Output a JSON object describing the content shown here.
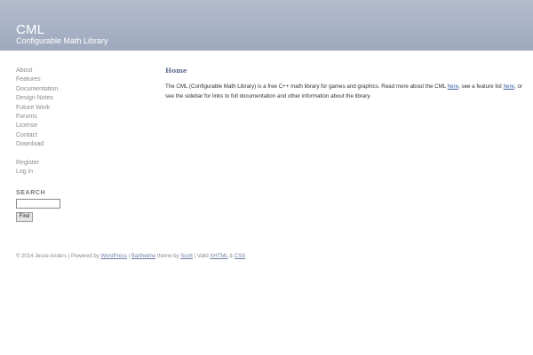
{
  "header": {
    "title": "CML",
    "description": "Configurable Math Library"
  },
  "sidebar": {
    "nav": [
      {
        "label": "About"
      },
      {
        "label": "Features"
      },
      {
        "label": "Documentation"
      },
      {
        "label": "Design Notes"
      },
      {
        "label": "Future Work"
      },
      {
        "label": "Forums"
      },
      {
        "label": "License"
      },
      {
        "label": "Contact"
      },
      {
        "label": "Download"
      }
    ],
    "meta": [
      {
        "label": "Register"
      },
      {
        "label": "Log in"
      }
    ],
    "search": {
      "heading": "SEARCH",
      "input_value": "",
      "button_label": "Find"
    }
  },
  "main": {
    "title": "Home",
    "intro": {
      "part1": "The CML (Configurable Math Library) is a free C++ math library for games and graphics. Read more about the CML ",
      "link1": "here",
      "part2": ", see a feature list ",
      "link2": "here",
      "part3": ", or see the sidebar for links to full documentation and other information about the library."
    }
  },
  "footer": {
    "copyright": "© 2014 Jesse Anders | Powered by ",
    "wordpress": "WordPress",
    "sep1": " | ",
    "theme": "Barthelme",
    "theme_by": " theme by ",
    "author": "Scott",
    "valid": " | Valid ",
    "xhtml": "XHTML",
    "amp": " & ",
    "css": "CSS"
  }
}
